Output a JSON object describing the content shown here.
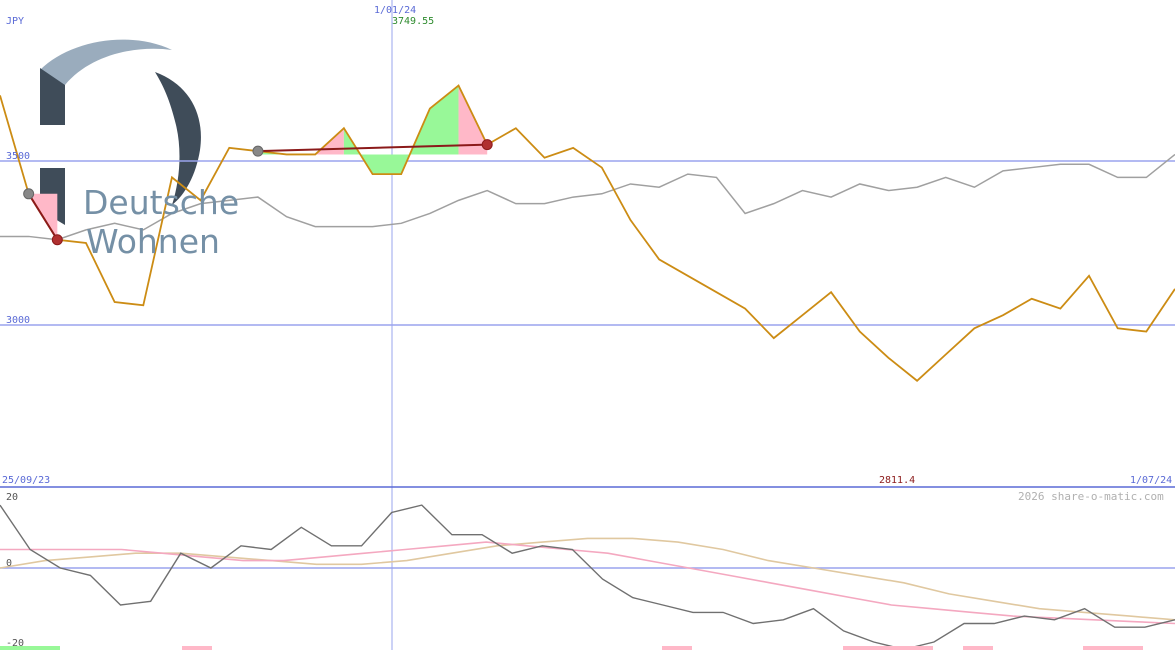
{
  "labels": {
    "currency": "JPY",
    "date_marker": "1/01/24",
    "marker_value": "3749.55",
    "start_date": "25/09/23",
    "end_date": "1/07/24",
    "low_value": "2811.4",
    "copyright": "2026 share-o-matic.com",
    "upper_ticks": [
      "3500",
      "3000"
    ],
    "lower_ticks": [
      "20",
      "0",
      "-20"
    ]
  },
  "logo": {
    "line1": "Deutsche",
    "line2": "Wohnen",
    "color": "#7590a6",
    "dark": "#3f4c59",
    "light": "#9aacbd"
  },
  "colors": {
    "price": "#cc8c14",
    "compare": "#a0a0a0",
    "grid": "#9aa4ee",
    "axis": "#5a6ad6",
    "trend": "#8b1a1a",
    "up_fill": "#98f898",
    "down_fill": "#ffb8c8",
    "osc": "#707070",
    "osc_pink": "#f4a8c0",
    "osc_tan": "#e0c8a0"
  },
  "chart_data": [
    {
      "type": "line",
      "title": "",
      "ylabel": "JPY",
      "ylim": [
        2510,
        3700
      ],
      "y_ticks": [
        3500,
        3000
      ],
      "series": [
        {
          "role": "price",
          "values": [
            3700,
            3400,
            3260,
            3250,
            3070,
            3060,
            3450,
            3380,
            3540,
            3530,
            3520,
            3520,
            3600,
            3460,
            3460,
            3660,
            3730,
            3550,
            3600,
            3510,
            3540,
            3480,
            3320,
            3200,
            3150,
            3100,
            3050,
            2960,
            3030,
            3100,
            2980,
            2900,
            2830,
            2910,
            2990,
            3030,
            3080,
            3050,
            3150,
            2990,
            2980,
            3110
          ]
        },
        {
          "role": "comparison",
          "values": [
            3270,
            3270,
            3260,
            3290,
            3310,
            3290,
            3340,
            3370,
            3380,
            3390,
            3330,
            3300,
            3300,
            3300,
            3310,
            3340,
            3380,
            3410,
            3370,
            3370,
            3390,
            3400,
            3430,
            3420,
            3460,
            3450,
            3340,
            3370,
            3410,
            3390,
            3430,
            3410,
            3420,
            3450,
            3420,
            3470,
            3480,
            3490,
            3490,
            3450,
            3450,
            3520
          ]
        }
      ]
    },
    {
      "type": "line",
      "title": "",
      "ylim": [
        -20,
        20
      ],
      "y_ticks": [
        20,
        0,
        -20
      ],
      "series": [
        {
          "role": "oscillator",
          "values": [
            17,
            5,
            0,
            -2,
            -10,
            -9,
            4,
            0,
            6,
            5,
            11,
            6,
            6,
            15,
            17,
            9,
            9,
            4,
            6,
            5,
            -3,
            -8,
            -10,
            -12,
            -12,
            -15,
            -14,
            -11,
            -17,
            -20,
            -22,
            -20,
            -15,
            -15,
            -13,
            -14,
            -11,
            -16,
            -16,
            -14
          ]
        },
        {
          "role": "signal-pink",
          "values": [
            5,
            5,
            5,
            5,
            4,
            3,
            2,
            2,
            3,
            4,
            5,
            6,
            7,
            6,
            5,
            4,
            2,
            0,
            -2,
            -4,
            -6,
            -8,
            -10,
            -11,
            -12,
            -13,
            -13.5,
            -14,
            -14.5,
            -15
          ]
        },
        {
          "role": "signal-tan",
          "values": [
            0,
            2,
            3,
            4,
            4,
            3,
            2,
            1,
            1,
            2,
            4,
            6,
            7,
            8,
            8,
            7,
            5,
            2,
            0,
            -2,
            -4,
            -7,
            -9,
            -11,
            -12,
            -13,
            -14
          ]
        }
      ]
    }
  ]
}
